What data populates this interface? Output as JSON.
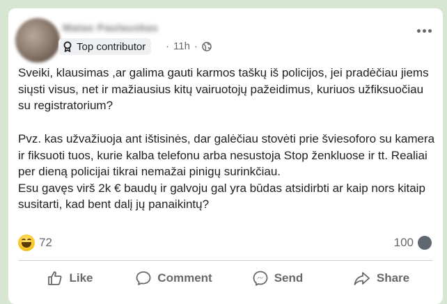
{
  "post": {
    "author_name": "Matas Paulauskas",
    "badge_label": "Top contributor",
    "timestamp": "11h",
    "separator": "·",
    "visibility_icon": "globe-icon",
    "paragraph_1": "Sveiki, klausimas ,ar galima gauti karmos taškų iš policijos, jei pradėčiau jiems siųsti visus, net ir mažiausius kitų vairuotojų pažeidimus, kuriuos užfiksuočiau su registratorium?",
    "paragraph_2": "Pvz. kas užvažiuoja ant ištisinės, dar galėčiau stovėti prie šviesoforo su kamera ir fiksuoti tuos, kurie kalba telefonu arba nesustoja Stop ženkluose ir tt. Realiai per dieną policijai tikrai nemažai pinigų surinkčiau.\nEsu gavęs virš 2k € baudų ir galvoju gal yra būdas atsidirbti ar kaip nors kitaip susitarti, kad bent dalį jų panaikintų?"
  },
  "stats": {
    "reaction_icon": "haha-emoji-icon",
    "reaction_count": "72",
    "comment_count": "100",
    "comment_icon": "comment-bubble-icon"
  },
  "actions": {
    "like_label": "Like",
    "comment_label": "Comment",
    "send_label": "Send",
    "share_label": "Share"
  },
  "colors": {
    "background": "#d7e6d2",
    "text": "#1c1e21",
    "secondary_text": "#65676b"
  }
}
